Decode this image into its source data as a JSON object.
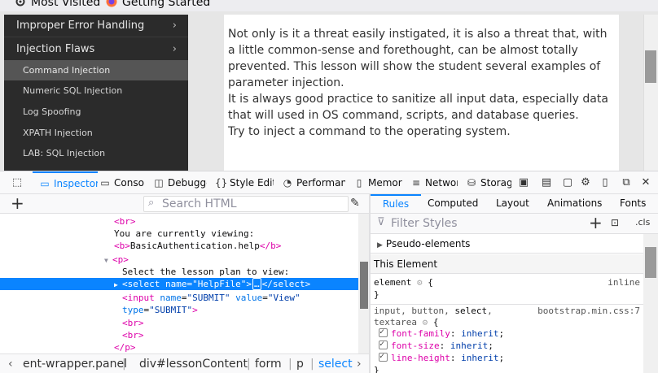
{
  "bookmarks": [
    {
      "label": "Most Visited",
      "icon": "gear-icon"
    },
    {
      "label": "Getting Started",
      "icon": "firefox-icon"
    }
  ],
  "sidebar": {
    "main_items": [
      {
        "label": "Improper Error Handling"
      },
      {
        "label": "Injection Flaws"
      }
    ],
    "sub_items": [
      {
        "label": "Command Injection",
        "active": true
      },
      {
        "label": "Numeric SQL Injection"
      },
      {
        "label": "Log Spoofing"
      },
      {
        "label": "XPATH Injection"
      },
      {
        "label": "LAB: SQL Injection"
      }
    ]
  },
  "lesson": {
    "para1": "Not only is it a threat easily instigated, it is also a threat that, with a little common-sense and forethought, can be almost totally prevented. This lesson will show the student several examples of parameter injection.",
    "para2": "It is always good practice to sanitize all input data, especially data that will used in OS command, scripts, and database queries.",
    "para3": "Try to inject a command to the operating system."
  },
  "devtools": {
    "tabs": [
      {
        "label": "Inspector",
        "icon": "inspector-icon",
        "active": true
      },
      {
        "label": "Console",
        "icon": "console-icon"
      },
      {
        "label": "Debugger",
        "icon": "debugger-icon"
      },
      {
        "label": "Style Editor",
        "icon": "style-editor-icon"
      },
      {
        "label": "Performance",
        "icon": "performance-icon"
      },
      {
        "label": "Memory",
        "icon": "memory-icon"
      },
      {
        "label": "Network",
        "icon": "network-icon"
      },
      {
        "label": "Storage",
        "icon": "storage-icon"
      }
    ],
    "search_placeholder": "Search HTML",
    "markup": {
      "br1": "<br>",
      "viewing": "You are currently viewing:",
      "b_open": "<b>",
      "b_text": "BasicAuthentication.help",
      "b_close": "</b>",
      "p_open": "<p>",
      "select_text": "Select the lesson plan to view:",
      "select_tag": "select",
      "select_attr": "name",
      "select_val": "\"HelpFile\"",
      "select_ellipsis": "…",
      "select_close": "</select>",
      "input_tag": "input",
      "input_name_attr": "name",
      "input_name_val": "\"SUBMIT\"",
      "input_value_attr": "value",
      "input_value_val": "\"View\"",
      "input_type_attr": "type",
      "input_type_val": "\"SUBMIT\"",
      "br2": "<br>",
      "br3": "<br>",
      "p_close": "</p>"
    },
    "breadcrumb": [
      "ent-wrapper.panel",
      "div#lessonContent",
      "form",
      "p",
      "select"
    ],
    "side_tabs": [
      "Rules",
      "Computed",
      "Layout",
      "Animations",
      "Fonts"
    ],
    "filter_placeholder": "Filter Styles",
    "cls_label": ".cls",
    "rules": {
      "pseudo": "Pseudo-elements",
      "this_element": "This Element",
      "element_selector": "element",
      "element_brace": "{",
      "inline_label": "inline",
      "close_brace": "}",
      "selector_line1_a": "input, button, ",
      "selector_line1_b": "select",
      "selector_line1_c": ",",
      "selector_line2": "textarea",
      "source": "bootstrap.min.css:7",
      "props": [
        {
          "name": "font-family",
          "value": "inherit"
        },
        {
          "name": "font-size",
          "value": "inherit"
        },
        {
          "name": "line-height",
          "value": "inherit"
        }
      ]
    }
  }
}
